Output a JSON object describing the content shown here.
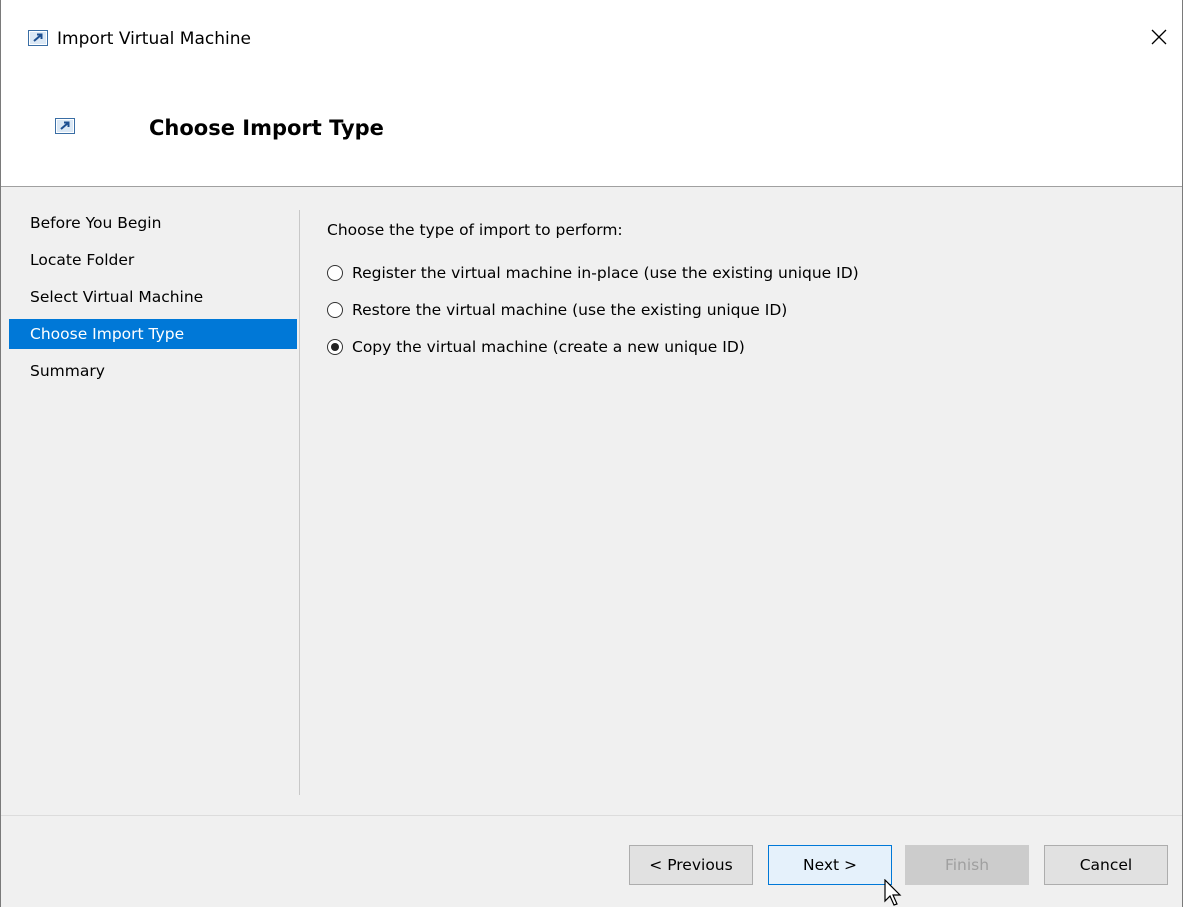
{
  "window": {
    "title": "Import Virtual Machine",
    "close_symbol": "✕",
    "icon": "vm-import-icon"
  },
  "header": {
    "title": "Choose Import Type",
    "icon": "vm-import-icon"
  },
  "nav": {
    "items": [
      {
        "label": "Before You Begin",
        "selected": false
      },
      {
        "label": "Locate Folder",
        "selected": false
      },
      {
        "label": "Select Virtual Machine",
        "selected": false
      },
      {
        "label": "Choose Import Type",
        "selected": true
      },
      {
        "label": "Summary",
        "selected": false
      }
    ]
  },
  "content": {
    "prompt": "Choose the type of import to perform:",
    "options": [
      {
        "label": "Register the virtual machine in-place (use the existing unique ID)",
        "selected": false
      },
      {
        "label": "Restore the virtual machine (use the existing unique ID)",
        "selected": false
      },
      {
        "label": "Copy the virtual machine (create a new unique ID)",
        "selected": true
      }
    ]
  },
  "buttons": {
    "previous": "< Previous",
    "next": "Next >",
    "finish": "Finish",
    "cancel": "Cancel"
  },
  "colors": {
    "accent": "#0078d7",
    "window_background": "#f0f0f0",
    "header_background": "#ffffff"
  }
}
